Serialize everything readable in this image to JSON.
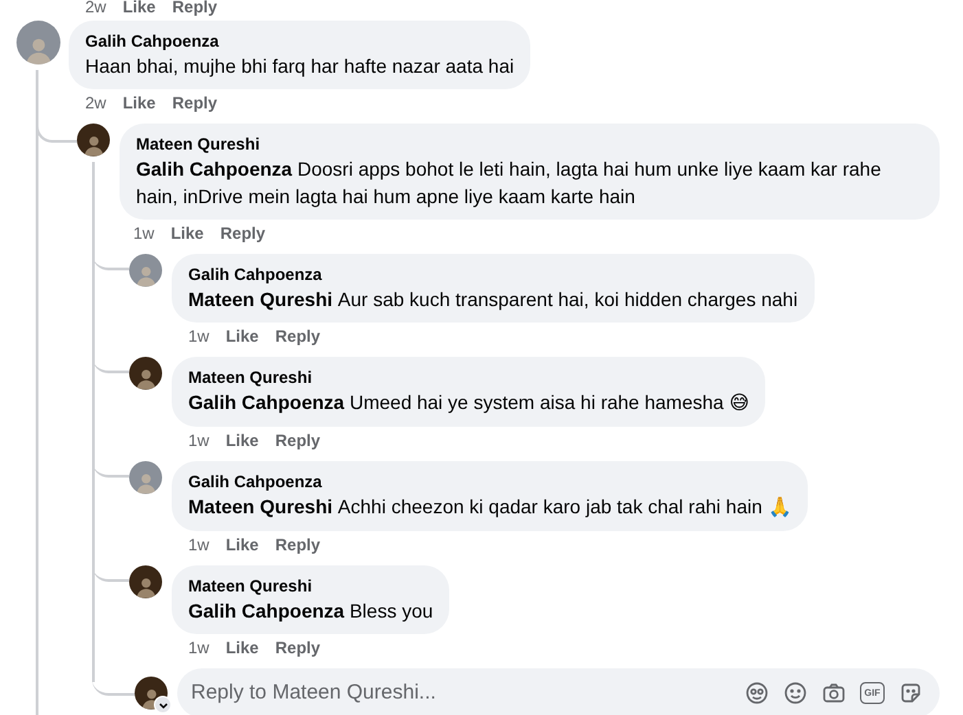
{
  "top_actions": {
    "time": "2w",
    "like": "Like",
    "reply": "Reply"
  },
  "comment": {
    "author": "Galih Cahpoenza",
    "color": "#8a9099",
    "text": "Haan bhai, mujhe bhi farq har hafte nazar aata hai",
    "time": "2w",
    "like": "Like",
    "reply": "Reply",
    "replies": [
      {
        "author": "Mateen Qureshi",
        "color": "#3a2716",
        "mention": "Galih Cahpoenza",
        "text": "Doosri apps bohot le leti hain, lagta hai hum unke liye kaam kar rahe hain, inDrive mein lagta hai hum apne liye kaam karte hain",
        "time": "1w",
        "like": "Like",
        "reply": "Reply",
        "replies": [
          {
            "author": "Galih Cahpoenza",
            "color": "#8a9099",
            "mention": "Mateen Qureshi",
            "text": "Aur sab kuch transparent hai, koi hidden charges nahi",
            "time": "1w",
            "like": "Like",
            "reply": "Reply"
          },
          {
            "author": "Mateen Qureshi",
            "color": "#3a2716",
            "mention": "Galih Cahpoenza",
            "text": "Umeed hai ye system aisa hi rahe hamesha",
            "emoji": "😅",
            "time": "1w",
            "like": "Like",
            "reply": "Reply"
          },
          {
            "author": "Galih Cahpoenza",
            "color": "#8a9099",
            "mention": "Mateen Qureshi",
            "text": "Achhi cheezon ki qadar karo jab tak chal rahi hain",
            "emoji": "🙏",
            "time": "1w",
            "like": "Like",
            "reply": "Reply"
          },
          {
            "author": "Mateen Qureshi",
            "color": "#3a2716",
            "mention": "Galih Cahpoenza",
            "text": "Bless you",
            "time": "1w",
            "like": "Like",
            "reply": "Reply"
          }
        ],
        "reply_box": {
          "color": "#3a2716",
          "placeholder": "Reply to Mateen Qureshi...",
          "gif_label": "GIF"
        }
      }
    ]
  }
}
